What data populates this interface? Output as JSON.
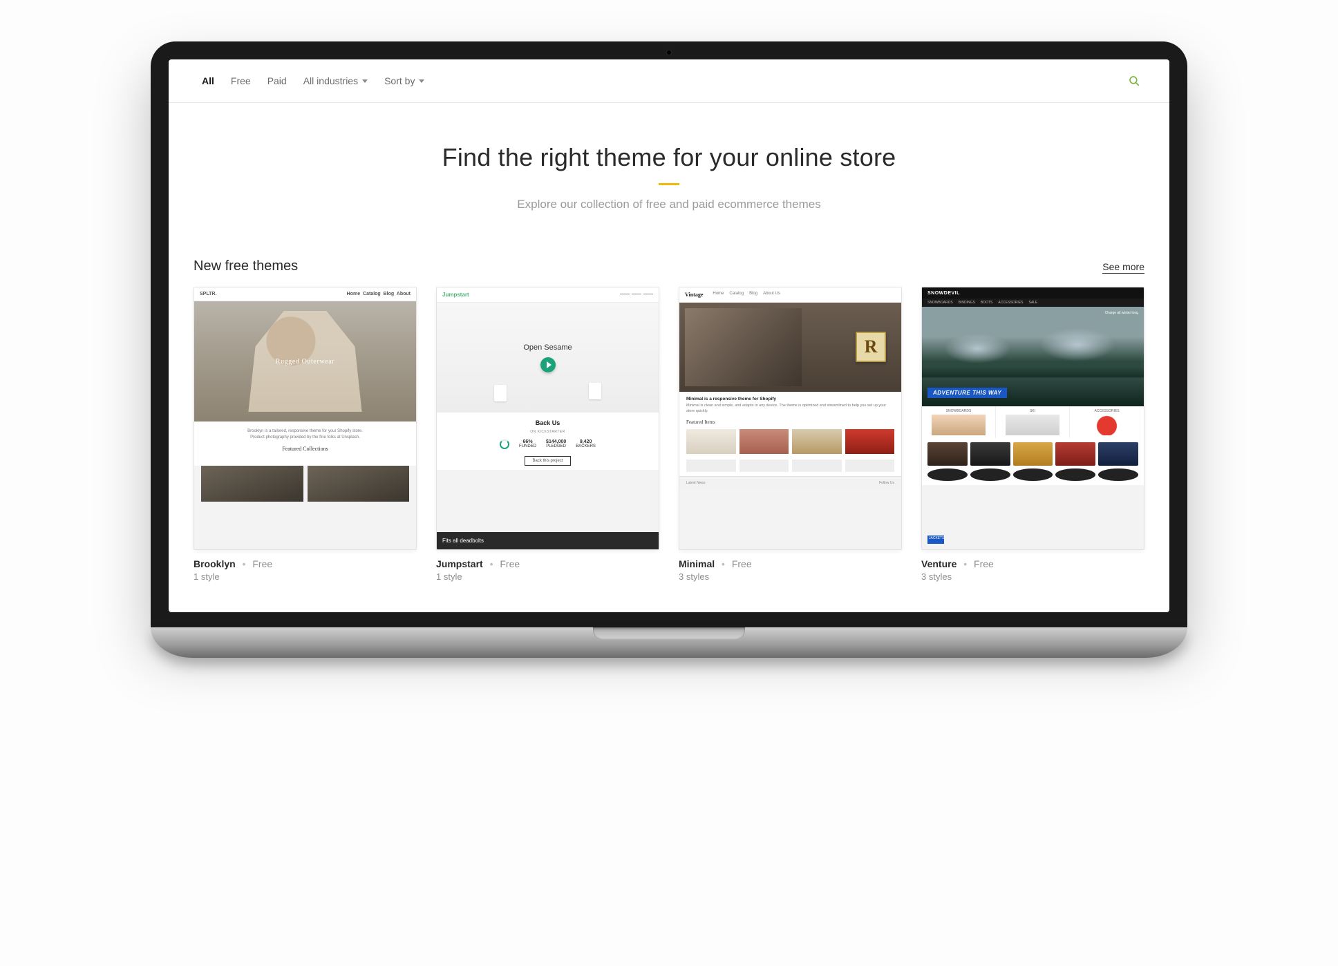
{
  "filters": {
    "all": "All",
    "free": "Free",
    "paid": "Paid",
    "industries": "All industries",
    "sort": "Sort by"
  },
  "hero": {
    "title": "Find the right theme for your online store",
    "subtitle": "Explore our collection of free and paid ecommerce themes"
  },
  "section": {
    "title": "New free themes",
    "see_more": "See more"
  },
  "themes": [
    {
      "name": "Brooklyn",
      "price": "Free",
      "styles": "1 style",
      "preview": {
        "brand": "SPLTR.",
        "nav": [
          "Home",
          "Catalog",
          "Blog",
          "About"
        ],
        "hero_text": "Rugged Outerwear",
        "blurb1": "Brooklyn is a tailored, responsive theme for your Shopify store.",
        "blurb2": "Product photography provided by the fine folks at Unsplash.",
        "subhead": "Featured Collections"
      }
    },
    {
      "name": "Jumpstart",
      "price": "Free",
      "styles": "1 style",
      "preview": {
        "logo": "Jumpstart",
        "hero_text": "Open Sesame",
        "back_us": "Back Us",
        "back_sub": "ON KICKSTARTER",
        "stats": [
          {
            "value": "66%",
            "label": "FUNDED"
          },
          {
            "value": "$144,000",
            "label": "PLEDGED"
          },
          {
            "value": "9,420",
            "label": "BACKERS"
          }
        ],
        "button": "Back this project",
        "footer": "Fits all deadbolts"
      }
    },
    {
      "name": "Minimal",
      "price": "Free",
      "styles": "3 styles",
      "preview": {
        "brand": "Vintage",
        "nav": [
          "Home",
          "Catalog",
          "Blog",
          "About Us"
        ],
        "headline": "Minimal is a responsive theme for Shopify",
        "blurb": "Minimal is clean and simple, and adapts to any device. The theme is optimized and streamlined to help you set up your store quickly.",
        "featured": "Featured Items",
        "footer_left": "Latest News",
        "footer_right": "Follow Us"
      }
    },
    {
      "name": "Venture",
      "price": "Free",
      "styles": "3 styles",
      "preview": {
        "brand": "SNOWDEVIL",
        "nav": [
          "SNOWBOARDS",
          "BINDINGS",
          "BOOTS",
          "ACCESSORIES",
          "SALE"
        ],
        "hero_tag": "ADVENTURE THIS WAY",
        "strap": "Charge all winter long",
        "cats": [
          "SNOWBOARDS",
          "SKI",
          "ACCESSORIES"
        ],
        "row_label": "JACKETS"
      }
    }
  ]
}
